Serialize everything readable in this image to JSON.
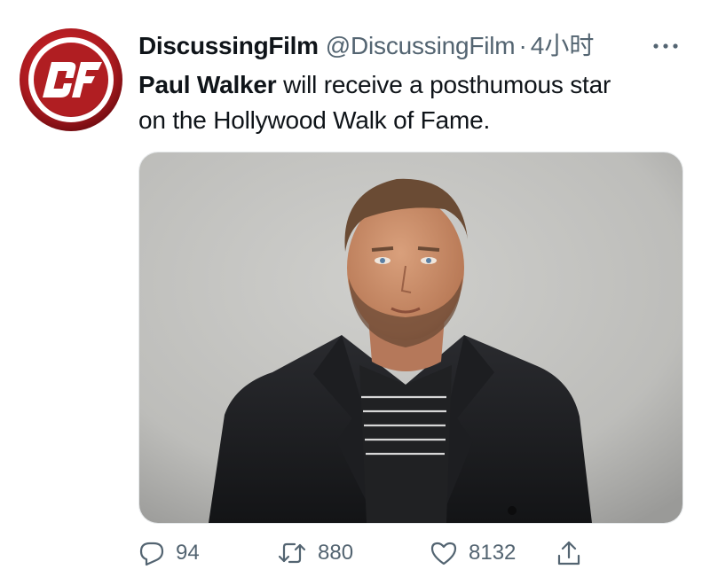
{
  "tweet": {
    "display_name": "DiscussingFilm",
    "handle": "@DiscussingFilm",
    "separator": "·",
    "timestamp": "4小时",
    "more_label": "···",
    "text_bold": "Paul Walker",
    "text_rest": " will receive a posthumous star",
    "text_line2": "on the Hollywood Walk of Fame.",
    "avatar_monogram": "DF",
    "avatar_icon": "discussingfilm-logo",
    "media_icon": "photo-portrait-man-dark-jacket"
  },
  "actions": {
    "reply_count": "94",
    "retweet_count": "880",
    "like_count": "8132",
    "reply_icon": "speech-bubble-icon",
    "retweet_icon": "retweet-arrows-icon",
    "like_icon": "heart-outline-icon",
    "share_icon": "share-upload-icon"
  },
  "colors": {
    "text_primary": "#0f1419",
    "text_secondary": "#536471",
    "avatar_red": "#b01e22",
    "avatar_dark": "#6e0b10"
  }
}
